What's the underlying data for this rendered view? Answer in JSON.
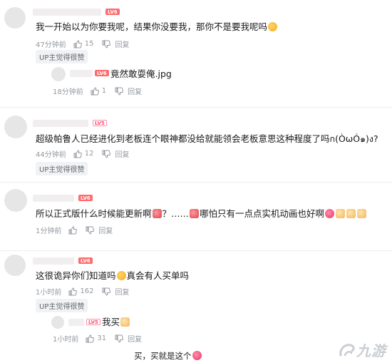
{
  "icons": {
    "like": "thumb-up-icon",
    "dislike": "thumb-down-icon"
  },
  "comments": [
    {
      "text": "我一开始以为你要我呢，结果你没要我，那你不是要我呢吗",
      "time": "47分钟前",
      "likes": "15",
      "reply": "回复",
      "up_tag": "UP主觉得很赞",
      "level": "LV6",
      "replies": [
        {
          "text": "竟然敢耍俺.jpg",
          "time": "18分钟前",
          "likes": "1",
          "reply": "回复",
          "level": "LV6"
        }
      ]
    },
    {
      "text": "超级帕鲁人已经进化到老板连个眼神都没给就能领会老板意思这种程度了吗ก(ÒωÓ๑)ง?",
      "time": "44分钟前",
      "likes": "12",
      "reply": "回复",
      "up_tag": "UP主觉得很赞",
      "level": "LV5"
    },
    {
      "text_a": "所以正式版什么时候能更新啊",
      "text_b": "？……",
      "text_c": "哪怕只有一点点实机动画也好啊",
      "time": "1分钟前",
      "likes": "",
      "reply": "回复",
      "level": "LV6"
    },
    {
      "text_a": "这很诡异你们知道吗",
      "text_b": "真会有人买单吗",
      "time": "1小时前",
      "likes": "162",
      "reply": "回复",
      "up_tag": "UP主觉得很赞",
      "level": "LV6",
      "replies": [
        {
          "text": "我买",
          "time": "1小时前",
          "likes": "31",
          "reply": "回复",
          "level": "LV5"
        }
      ]
    }
  ],
  "bottom_line": "买，买就是这个",
  "watermark": "九游"
}
